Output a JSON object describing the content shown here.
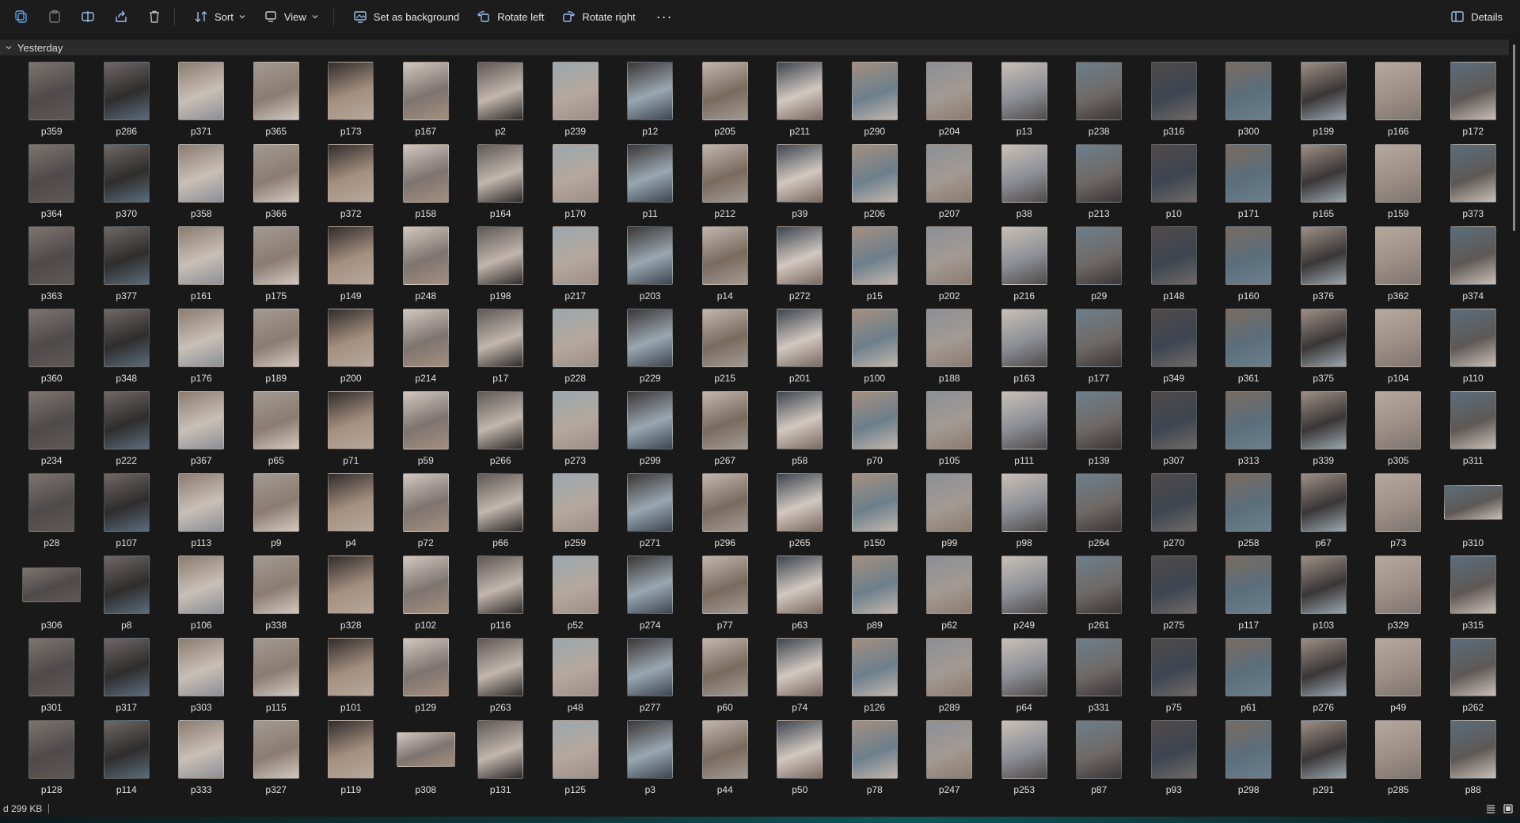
{
  "toolbar": {
    "icons": [
      "copy-icon",
      "paste-icon",
      "rename-icon",
      "share-icon",
      "delete-icon"
    ],
    "sort_label": "Sort",
    "view_label": "View",
    "set_background_label": "Set as background",
    "rotate_left_label": "Rotate left",
    "rotate_right_label": "Rotate right",
    "more_label": "···",
    "details_label": "Details"
  },
  "group": {
    "header": "Yesterday"
  },
  "files": [
    "p359",
    "p286",
    "p371",
    "p365",
    "p173",
    "p167",
    "p2",
    "p239",
    "p12",
    "p205",
    "p211",
    "p290",
    "p204",
    "p13",
    "p238",
    "p316",
    "p300",
    "p199",
    "p166",
    "p172",
    "p364",
    "p370",
    "p358",
    "p366",
    "p372",
    "p158",
    "p164",
    "p170",
    "p11",
    "p212",
    "p39",
    "p206",
    "p207",
    "p38",
    "p213",
    "p10",
    "p171",
    "p165",
    "p159",
    "p373",
    "p363",
    "p377",
    "p161",
    "p175",
    "p149",
    "p248",
    "p198",
    "p217",
    "p203",
    "p14",
    "p272",
    "p15",
    "p202",
    "p216",
    "p29",
    "p148",
    "p160",
    "p376",
    "p362",
    "p374",
    "p360",
    "p348",
    "p176",
    "p189",
    "p200",
    "p214",
    "p17",
    "p228",
    "p229",
    "p215",
    "p201",
    "p100",
    "p188",
    "p163",
    "p177",
    "p349",
    "p361",
    "p375",
    "p104",
    "p110",
    "p234",
    "p222",
    "p367",
    "p65",
    "p71",
    "p59",
    "p266",
    "p273",
    "p299",
    "p267",
    "p58",
    "p70",
    "p105",
    "p111",
    "p139",
    "p307",
    "p313",
    "p339",
    "p305",
    "p311",
    "p28",
    "p107",
    "p113",
    "p9",
    "p4",
    "p72",
    "p66",
    "p259",
    "p271",
    "p296",
    "p265",
    "p150",
    "p99",
    "p98",
    "p264",
    "p270",
    "p258",
    "p67",
    "p73",
    "p310",
    "p306",
    "p8",
    "p106",
    "p338",
    "p328",
    "p102",
    "p116",
    "p52",
    "p274",
    "p77",
    "p63",
    "p89",
    "p62",
    "p249",
    "p261",
    "p275",
    "p117",
    "p103",
    "p329",
    "p315",
    "p301",
    "p317",
    "p303",
    "p115",
    "p101",
    "p129",
    "p263",
    "p48",
    "p277",
    "p60",
    "p74",
    "p126",
    "p289",
    "p64",
    "p331",
    "p75",
    "p61",
    "p276",
    "p49",
    "p262",
    "p128",
    "p114",
    "p333",
    "p327",
    "p119",
    "p308",
    "p131",
    "p125",
    "p3",
    "p44",
    "p50",
    "p78",
    "p247",
    "p253",
    "p87",
    "p93",
    "p298",
    "p291",
    "p285",
    "p88"
  ],
  "landscape_files": [
    "p310",
    "p306",
    "p308"
  ],
  "status": {
    "text": "d  299 KB"
  },
  "colors": {
    "background": "#191919",
    "group_header": "#2b2b2b",
    "thumb_palette": [
      "#7d7470",
      "#a39a93",
      "#5e5855",
      "#c2b6ad",
      "#8c8f96",
      "#4f4a4a",
      "#b5a89c",
      "#6f6966",
      "#2f2c2c",
      "#9aa7b0",
      "#3d4550",
      "#c9bfb6",
      "#7a6a5e",
      "#5a6e7c",
      "#8b7b70",
      "#d2c8c0",
      "#3a3636",
      "#a58f7e",
      "#6c7f8c",
      "#9e8f86"
    ]
  }
}
